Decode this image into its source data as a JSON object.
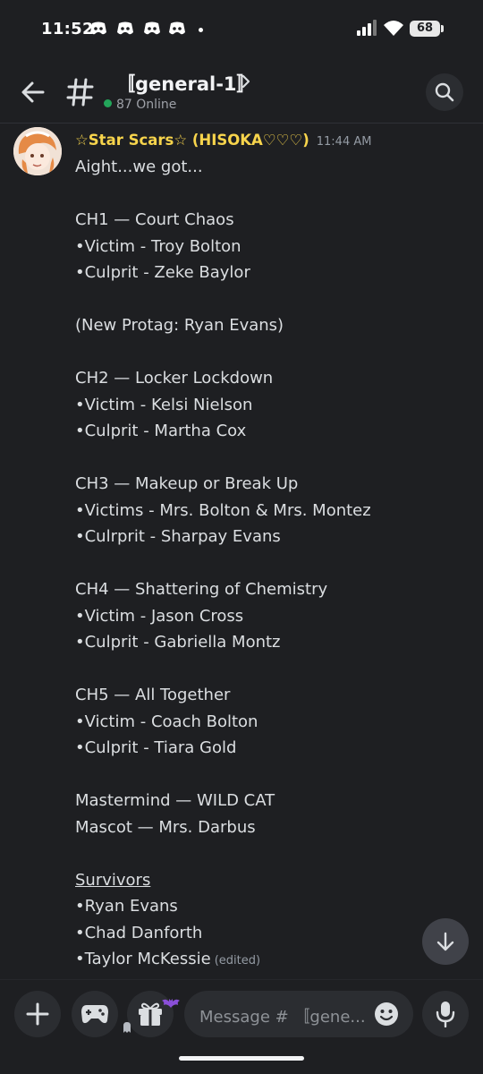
{
  "status_bar": {
    "time": "11:52",
    "battery": "68",
    "notification_icons": [
      "discord-icon",
      "discord-icon",
      "discord-icon",
      "discord-icon"
    ]
  },
  "header": {
    "channel_name": "〚general-1〛",
    "online_count": "87 Online"
  },
  "message": {
    "author": "☆Star Scars☆ (HISOKA♡♡♡)",
    "timestamp": "11:44 AM",
    "author_color": "#f7d44c",
    "lines": [
      "Aight...we got...",
      "",
      "CH1 — Court Chaos",
      "•Victim - Troy Bolton",
      "•Culprit - Zeke Baylor",
      "",
      "(New Protag: Ryan Evans)",
      "",
      "CH2 — Locker Lockdown",
      "•Victim - Kelsi Nielson",
      "•Culprit - Martha Cox",
      "",
      "CH3 — Makeup or Break Up",
      "•Victims - Mrs. Bolton & Mrs. Montez",
      "•Culrprit - Sharpay Evans",
      "",
      "CH4 — Shattering of Chemistry",
      "•Victim - Jason Cross",
      "•Culprit - Gabriella Montz",
      "",
      "CH5 — All Together",
      "•Victim - Coach Bolton",
      "•Culprit - Tiara Gold",
      "",
      "Mastermind — WILD CAT",
      "Mascot — Mrs. Darbus",
      "",
      "Survivors",
      "•Ryan Evans",
      "•Chad Danforth",
      "•Taylor McKessie"
    ],
    "edited_label": "(edited)"
  },
  "composer": {
    "placeholder": "Message # 〚gene..."
  },
  "colors": {
    "background": "#1e1f22",
    "accent_online": "#23a55a"
  }
}
